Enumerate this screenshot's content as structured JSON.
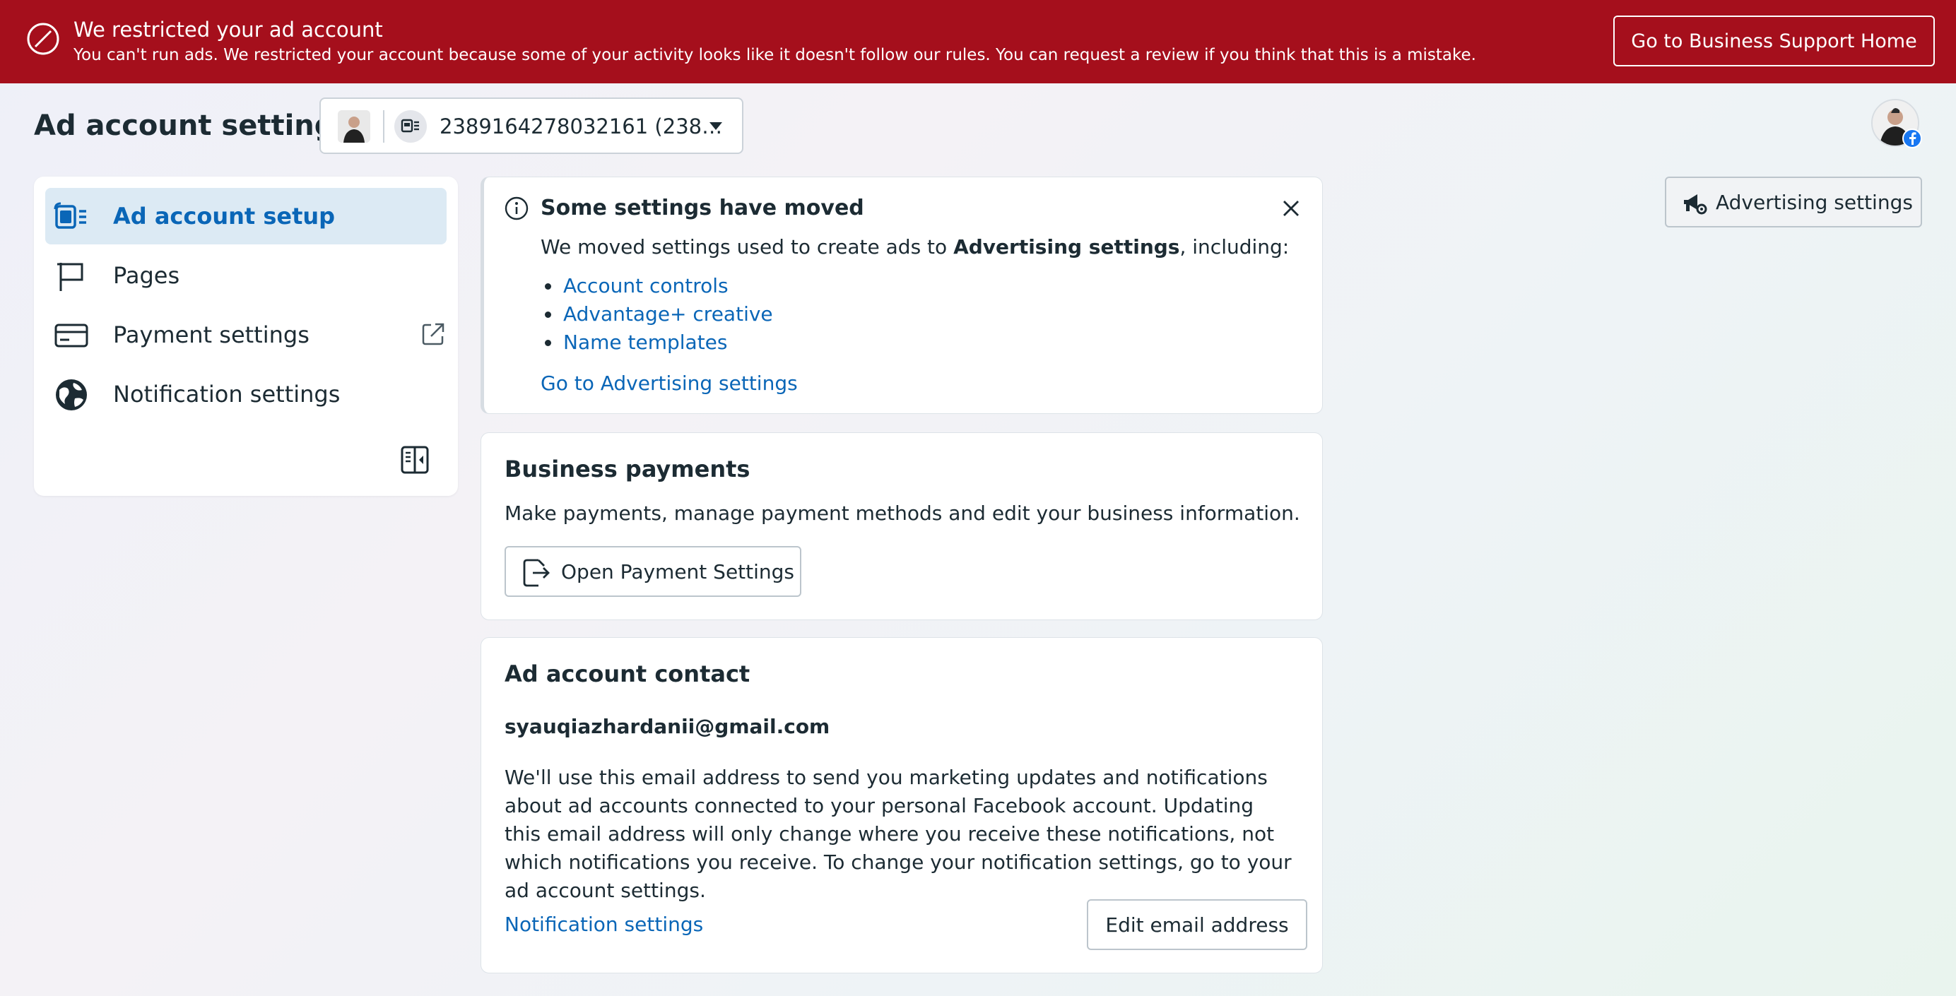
{
  "banner": {
    "icon": "restricted-icon",
    "title": "We restricted your ad account",
    "text": "You can't run ads. We restricted your account because some of your activity looks like it doesn't follow our rules. You can request a review if you think that this is a mistake.",
    "button_label": "Go to Business Support Home",
    "background_color": "#a50f1c"
  },
  "header": {
    "title": "Ad account settings",
    "account_selector": {
      "value": "2389164278032161 (238…",
      "icon": "ad-account-icon",
      "caret_icon": "caret-down-icon"
    },
    "profile_icon": "profile-avatar",
    "badge_icon": "facebook-icon"
  },
  "sidebar": {
    "items": [
      {
        "label": "Ad account setup",
        "icon": "ad-account-setup-icon",
        "active": true
      },
      {
        "label": "Pages",
        "icon": "flag-icon",
        "active": false
      },
      {
        "label": "Payment settings",
        "icon": "credit-card-icon",
        "active": false,
        "external_icon": "external-link-icon"
      },
      {
        "label": "Notification settings",
        "icon": "globe-icon",
        "active": false
      }
    ],
    "collapse_icon": "collapse-sidebar-icon"
  },
  "notice": {
    "icon": "info-icon",
    "title": "Some settings have moved",
    "body_prefix": "We moved settings used to create ads to ",
    "body_bold": "Advertising settings",
    "body_suffix": ", including:",
    "links": [
      "Account controls",
      "Advantage+ creative",
      "Name templates"
    ],
    "cta_label": "Go to Advertising settings",
    "close_icon": "close-icon"
  },
  "payments": {
    "title": "Business payments",
    "text": "Make payments, manage payment methods and edit your business information.",
    "button_label": "Open Payment Settings",
    "button_icon": "open-external-icon"
  },
  "contact": {
    "title": "Ad account contact",
    "email": "syauqiazhardanii@gmail.com",
    "description": "We'll use this email address to send you marketing updates and notifications about ad accounts connected to your personal Facebook account. Updating this email address will only change where you receive these notifications, not which notifications you receive. To change your notification settings, go to your ad account settings.",
    "link_label": "Notification settings",
    "button_label": "Edit email address"
  },
  "advertising_button": {
    "label": "Advertising settings",
    "icon": "megaphone-gear-icon"
  },
  "colors": {
    "link": "#0a66b7",
    "active_nav_bg": "#dceaf4",
    "text": "#1c2b33"
  }
}
